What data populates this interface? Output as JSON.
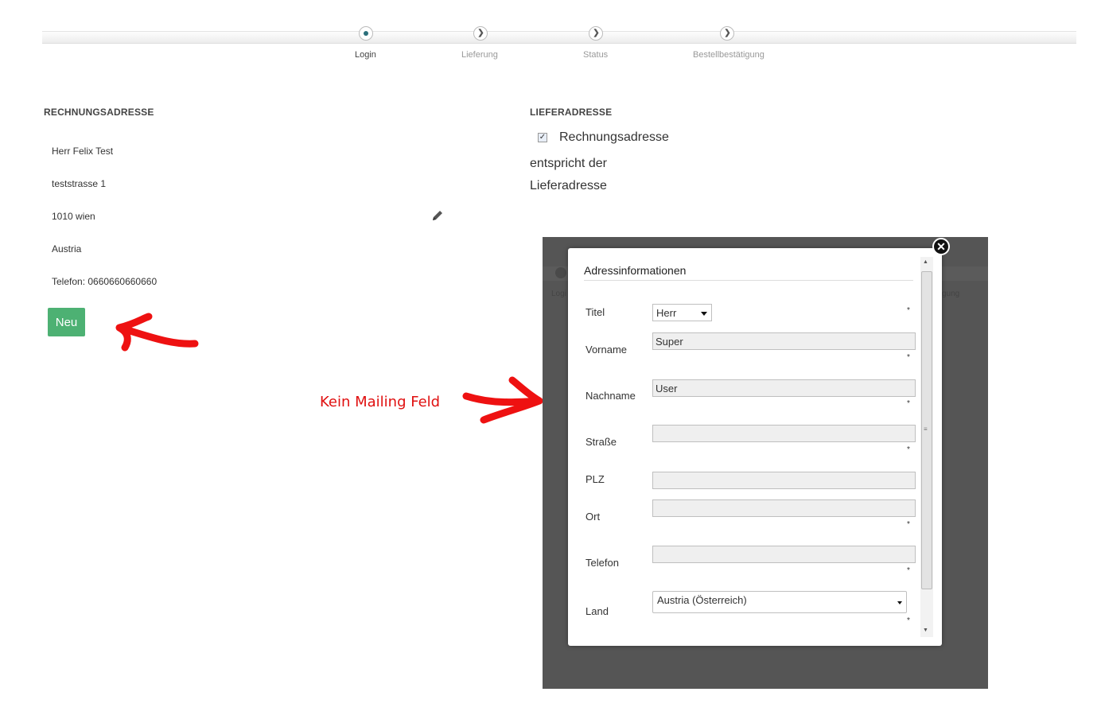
{
  "steps": [
    {
      "label": "Login",
      "state": "active"
    },
    {
      "label": "Lieferung",
      "state": "pending"
    },
    {
      "label": "Status",
      "state": "pending"
    },
    {
      "label": "Bestellbestätigung",
      "state": "pending"
    }
  ],
  "billing": {
    "heading": "RECHNUNGSADRESSE",
    "name": "Herr Felix Test",
    "street": "teststrasse 1",
    "city": "1010 wien",
    "country": "Austria",
    "phone": "Telefon: 0660660660660",
    "new_button": "Neu",
    "edit_icon": "pencil-icon"
  },
  "shipping": {
    "heading": "LIEFERADRESSE",
    "checkbox_checked": true,
    "checkbox_label": "Rechnungsadresse",
    "text_line1": "entspricht der",
    "text_line2": "Lieferadresse"
  },
  "annotation": {
    "text": "Kein Mailing Feld",
    "color": "#e01010"
  },
  "background_ghost": {
    "login": "Logi",
    "last": "gung"
  },
  "dialog": {
    "title": "Adressinformationen",
    "close_icon": "close-icon",
    "required_marker": "*",
    "fields": {
      "titel": {
        "label": "Titel",
        "value": "Herr"
      },
      "vorname": {
        "label": "Vorname",
        "value": "Super"
      },
      "nachname": {
        "label": "Nachname",
        "value": "User"
      },
      "strasse": {
        "label": "Straße",
        "value": ""
      },
      "plz": {
        "label": "PLZ",
        "value": ""
      },
      "ort": {
        "label": "Ort",
        "value": ""
      },
      "telefon": {
        "label": "Telefon",
        "value": ""
      },
      "land": {
        "label": "Land",
        "value": "Austria (Österreich)"
      }
    }
  },
  "colors": {
    "accent_green": "#4db173",
    "step_active": "#2b6f7a",
    "overlay": "#555555"
  }
}
